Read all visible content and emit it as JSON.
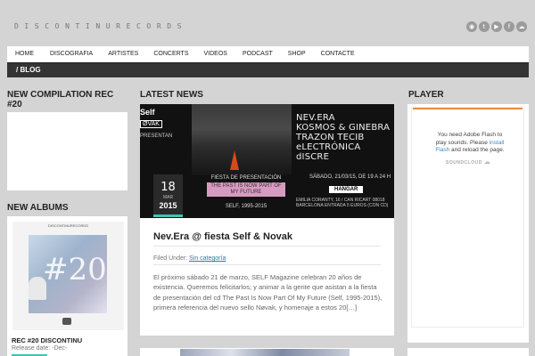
{
  "site": {
    "title": "DISCONTINURECORDS"
  },
  "social_icons": [
    {
      "name": "rss-icon",
      "glyph": "◉"
    },
    {
      "name": "twitter-icon",
      "glyph": "t"
    },
    {
      "name": "youtube-icon",
      "glyph": "▶"
    },
    {
      "name": "facebook-icon",
      "glyph": "f"
    },
    {
      "name": "soundcloud-icon",
      "glyph": "☁"
    }
  ],
  "nav": {
    "items": [
      "HOME",
      "DISCOGRAFIA",
      "ARTISTES",
      "CONCERTS",
      "VIDEOS",
      "PODCAST",
      "SHOP",
      "CONTACTE"
    ]
  },
  "subnav": {
    "label": "/ BLOG"
  },
  "sidebar_left": {
    "compilation_title": "NEW COMPILATION REC #20",
    "albums_title": "NEW ALBUMS",
    "album": {
      "cover_header": "DISCONTINURECORDS",
      "cover_number": "#20",
      "title": "REC #20 DISCONTINU",
      "release_date": "Release date: -Dec-"
    }
  },
  "main": {
    "section_title": "LATEST NEWS",
    "post": {
      "image": {
        "left_brand": "Self",
        "left_box": "ØVAK",
        "left_sub": "PRESENTAN",
        "lines": [
          "NEV.ERA",
          "KOSMOS & GINEBRA",
          "TRAZON TECIB",
          "eLECTRÓNICA dISCRE"
        ],
        "date_line": "SÁBADO, 21/03/15, DE 19 A 24 H",
        "venue": "HANGAR",
        "address": "EMILIA CORANTY, 16 / CAN RICART 08018 BARCELONA ENTRADA 5 EUROS (CON CD)",
        "fiesta": "FIESTA DE PRESENTACIÓN",
        "pink_box": "THE PAST IS NOW PART OF MY FUTURE",
        "self_line": "SELF, 1995-2015"
      },
      "date": {
        "day": "18",
        "month": "MAR",
        "year": "2015"
      },
      "title": "Nev.Era @ fiesta Self & Novak",
      "filed_label": "Filed Under:",
      "category": "Sin categoría",
      "excerpt": "El próximo sábado 21 de marzo, SELF Magazine celebran 20 años de existencia. Queremos felicitarlos; y animar a la gente que asistan a la fiesta de presentación del cd The Past Is Now Part Of My Future (Self, 1995-2015), primera referencia del nuevo sello Nøvak, y homenaje a estos 20[…]"
    }
  },
  "sidebar_right": {
    "title": "PLAYER",
    "flash_msg_1": "You need Adobe Flash to play sounds. Please",
    "flash_link": "install Flash",
    "flash_msg_2": "and reload the page.",
    "soundcloud_label": "SOUNDCLOUD"
  },
  "colors": {
    "accent": "#3ac7b4",
    "player_bar": "#f08a3a",
    "link": "#2d7b9e",
    "background": "#d4d4d4",
    "dark_bar": "#343434"
  }
}
